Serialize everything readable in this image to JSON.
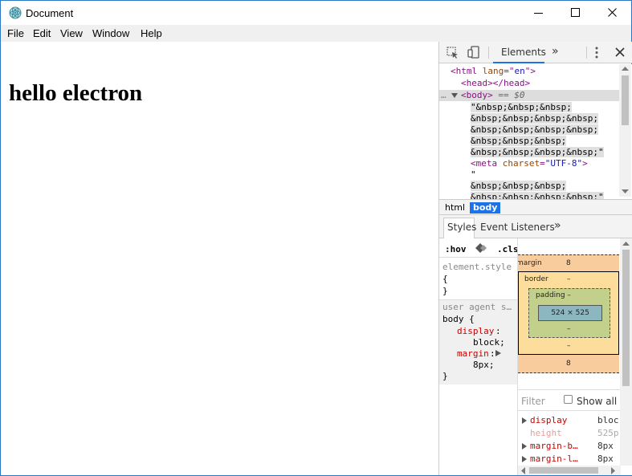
{
  "window": {
    "title": "Document"
  },
  "menu": [
    "File",
    "Edit",
    "View",
    "Window",
    "Help"
  ],
  "content": {
    "heading": "hello electron"
  },
  "devtools": {
    "tabs": {
      "elements": "Elements",
      "more": "»"
    },
    "dom": {
      "html_open_tag": "<html",
      "html_attr_name": "lang",
      "html_attr_eq": "=\"",
      "html_attr_value": "en",
      "html_tail": "\">",
      "head": "<head></head>",
      "body_dots": "…",
      "body_tag": "<body>",
      "body_suffix": "== $0",
      "text_lines": [
        "\"&nbsp;&nbsp;&nbsp;",
        "&nbsp;&nbsp;&nbsp;&nbsp;",
        "&nbsp;&nbsp;&nbsp;&nbsp;",
        "&nbsp;&nbsp;&nbsp;",
        "&nbsp;&nbsp;&nbsp;&nbsp;\""
      ],
      "meta_open": "<meta",
      "meta_attr": "charset",
      "meta_value": "\"UTF-8\"",
      "meta_close": ">",
      "quote": "\"",
      "after_meta": [
        "&nbsp;&nbsp;&nbsp;",
        "&nbsp;&nbsp;&nbsp;&nbsp;\""
      ]
    },
    "breadcrumbs": [
      "html",
      "body"
    ],
    "subtabs": {
      "styles": "Styles",
      "event_listeners": "Event Listeners",
      "more": "»"
    },
    "styles": {
      "hov": ":hov",
      "cls": ".cls",
      "element_style": "element.style",
      "open_brace": "{",
      "close_brace": "}",
      "ua_label": "user agent s…",
      "body_selector": "body {",
      "display_prop": "display",
      "display_val": "block;",
      "margin_prop": "margin",
      "margin_val": "8px;"
    },
    "box_model": {
      "margin_label": "margin",
      "margin_top": "8",
      "border_label": "border",
      "border_val": "–",
      "padding_label": "padding –",
      "content_size": "524 × 525",
      "dash": "–",
      "margin_bottom": "8"
    },
    "filter": {
      "placeholder": "Filter",
      "show_all": "Show all"
    },
    "computed_props": [
      {
        "name": "display",
        "value": "bloc",
        "color": "#c80000"
      },
      {
        "name": "height",
        "value": "525p",
        "color": "#e6a0a0"
      },
      {
        "name": "margin-b…",
        "value": "8px",
        "color": "#c80000"
      },
      {
        "name": "margin-l…",
        "value": "8px",
        "color": "#c80000"
      }
    ]
  },
  "colors": {
    "accent": "#1a73e8",
    "window_border": "#2b78c5"
  }
}
